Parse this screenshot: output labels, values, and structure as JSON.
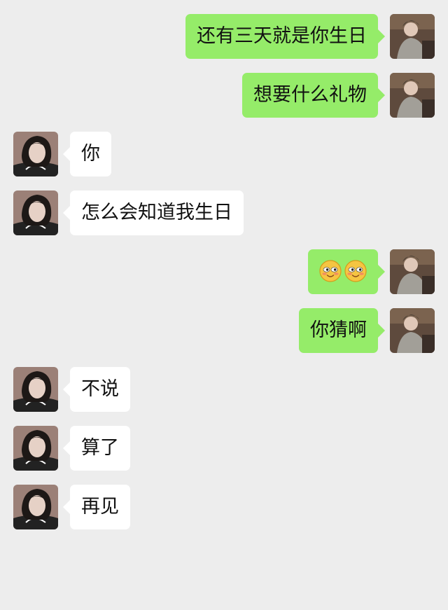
{
  "chat": {
    "messages": [
      {
        "side": "right",
        "type": "text",
        "text": "还有三天就是你生日"
      },
      {
        "side": "right",
        "type": "text",
        "text": "想要什么礼物"
      },
      {
        "side": "left",
        "type": "text",
        "text": "你"
      },
      {
        "side": "left",
        "type": "text",
        "text": "怎么会知道我生日"
      },
      {
        "side": "right",
        "type": "emoji",
        "emoji": [
          "blush-face-icon",
          "blush-face-icon"
        ]
      },
      {
        "side": "right",
        "type": "text",
        "text": "你猜啊"
      },
      {
        "side": "left",
        "type": "text",
        "text": "不说"
      },
      {
        "side": "left",
        "type": "text",
        "text": "算了"
      },
      {
        "side": "left",
        "type": "text",
        "text": "再见"
      }
    ]
  },
  "colors": {
    "background": "#ededed",
    "sent_bubble": "#95ec69",
    "received_bubble": "#ffffff"
  }
}
